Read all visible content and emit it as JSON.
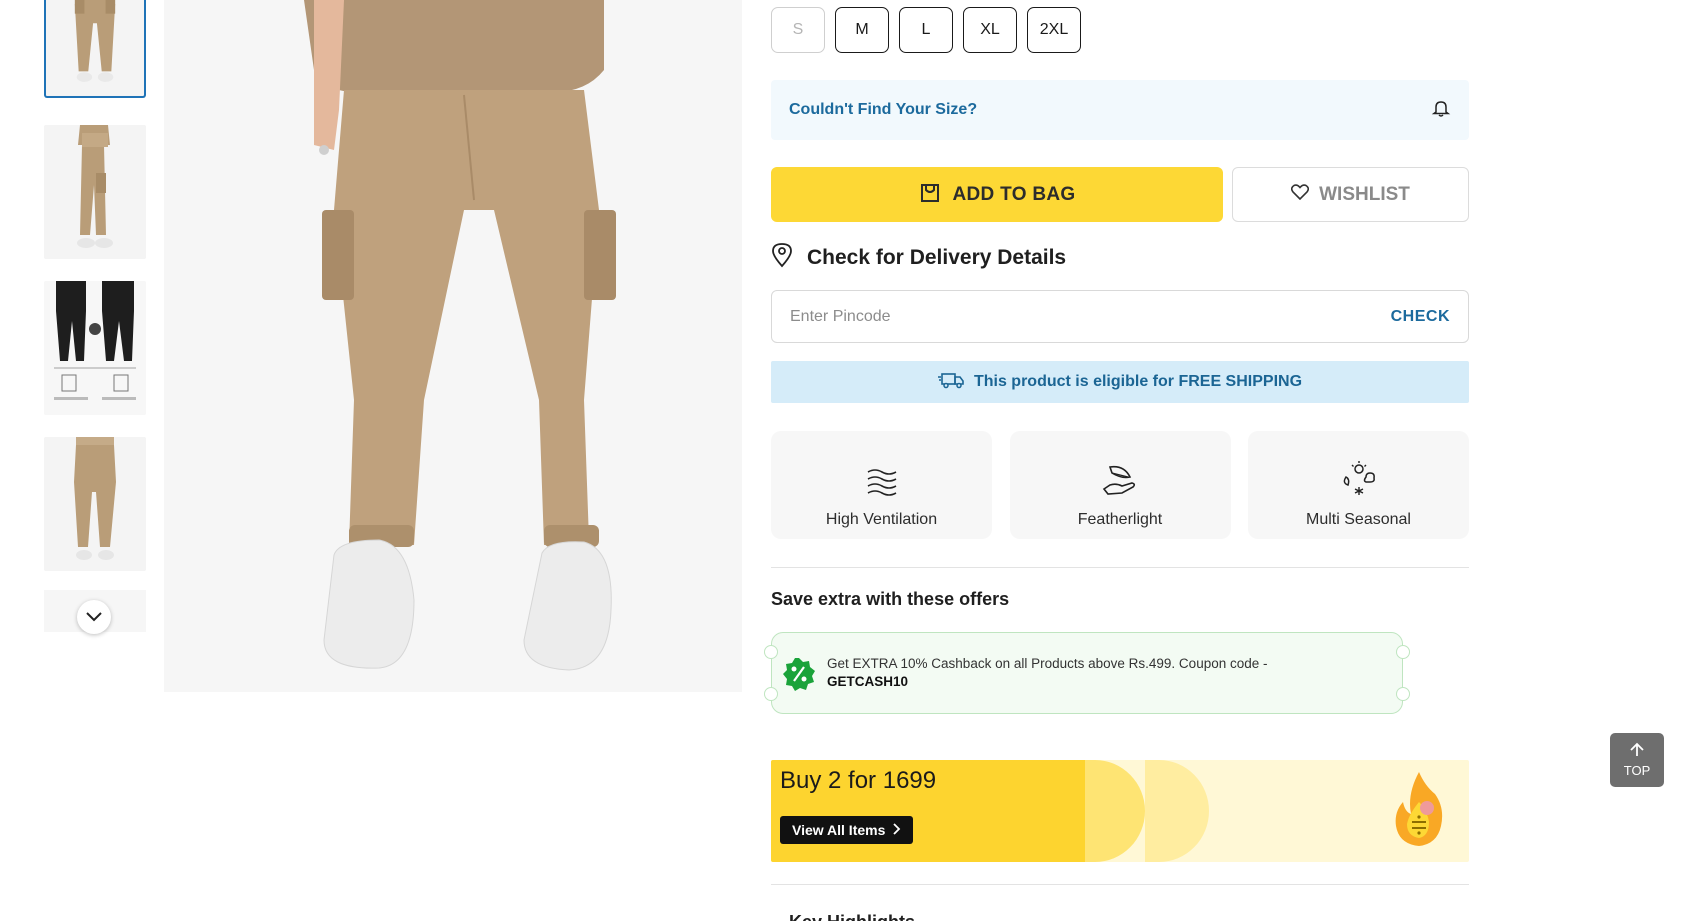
{
  "gallery": {
    "thumbnails": [
      "thumb-front",
      "thumb-side",
      "thumb-fit-compare",
      "thumb-back"
    ],
    "scroll_icon": "chevron-down-icon"
  },
  "sizes": [
    {
      "label": "S",
      "available": false
    },
    {
      "label": "M",
      "available": true
    },
    {
      "label": "L",
      "available": true
    },
    {
      "label": "XL",
      "available": true
    },
    {
      "label": "2XL",
      "available": true
    }
  ],
  "size_help": {
    "text": "Couldn't Find Your Size?",
    "icon": "bell-icon"
  },
  "actions": {
    "add_to_bag": "ADD TO BAG",
    "wishlist": "WISHLIST"
  },
  "delivery": {
    "title": "Check for Delivery Details",
    "pincode_placeholder": "Enter Pincode",
    "check_label": "CHECK",
    "shipping_prefix": "This product is eligible for ",
    "shipping_highlight": "FREE SHIPPING"
  },
  "features": [
    {
      "label": "High Ventilation",
      "icon": "ventilation-icon"
    },
    {
      "label": "Featherlight",
      "icon": "feather-hand-icon"
    },
    {
      "label": "Multi Seasonal",
      "icon": "seasons-icon"
    }
  ],
  "offers": {
    "title": "Save extra with these offers",
    "coupon_text": "Get EXTRA 10% Cashback on all Products above Rs.499. Coupon code - ",
    "coupon_code": "GETCASH10"
  },
  "banner": {
    "title": "Buy 2 for 1699",
    "button": "View All Items"
  },
  "key_highlights": "Key Highlights",
  "scroll_top": "TOP",
  "colors": {
    "accent_yellow": "#fdd835",
    "link_blue": "#1c6a9d",
    "shipping_bg": "#d5ecf9",
    "coupon_green": "#1aa33a"
  }
}
